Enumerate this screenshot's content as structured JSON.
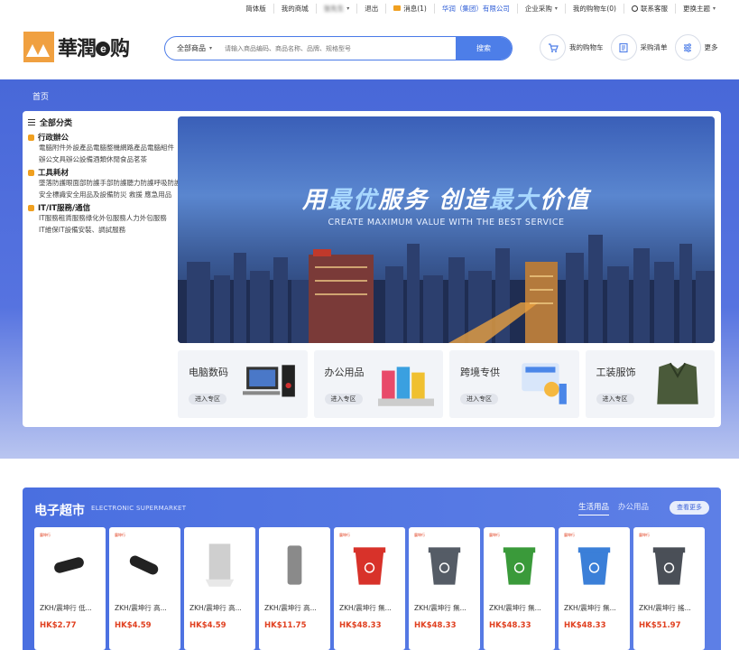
{
  "topbar": {
    "language": "简体版",
    "my_mall": "我的商城",
    "account": "张先生",
    "logout": "退出",
    "messages": "消息(1)",
    "company": "华润（集团）有限公司",
    "enterprise": "企业采购",
    "cart": "我的购物车(0)",
    "service": "联系客服",
    "theme": "更换主题"
  },
  "logo": {
    "text": "華潤",
    "suffix": "购",
    "e": "e"
  },
  "search": {
    "category": "全部商品",
    "placeholder": "请输入商品编码、商品名称、品牌、规格型号",
    "button": "搜索"
  },
  "header_actions": [
    {
      "label": "我的购物车",
      "icon": "cart-icon"
    },
    {
      "label": "采购清单",
      "icon": "list-icon"
    },
    {
      "label": "更多",
      "icon": "more-icon"
    }
  ],
  "hero": {
    "home": "首页"
  },
  "categories": {
    "title": "全部分类",
    "groups": [
      {
        "title": "行政辦公",
        "items": [
          "電腦附件",
          "外設產品",
          "電腦整機",
          "網路產品",
          "電腦組件",
          "辦公文具",
          "辦公設備",
          "酒類",
          "休閒食品",
          "茗茶"
        ]
      },
      {
        "title": "工具耗材",
        "items": [
          "墜落防護",
          "眼面部防護",
          "手部防護",
          "聽力防護",
          "呼吸防護",
          "安全標識",
          "安全用品及設備",
          "防災 救援 應急用品"
        ]
      },
      {
        "title": "IT/IT服務/通信",
        "items": [
          "IT服務",
          "租賃服務",
          "綠化外包服務",
          "人力外包服務",
          "IT維保",
          "IT設備安裝、調試服務"
        ]
      }
    ]
  },
  "banner": {
    "title_part1": "用",
    "title_hl1": "最优",
    "title_part2": "服务 创造",
    "title_hl2": "最大",
    "title_part3": "价值",
    "subtitle": "CREATE MAXIMUM VALUE WITH THE BEST SERVICE"
  },
  "tiles": [
    {
      "name": "电脑数码",
      "button": "进入专区"
    },
    {
      "name": "办公用品",
      "button": "进入专区"
    },
    {
      "name": "跨境专供",
      "button": "进入专区"
    },
    {
      "name": "工装服饰",
      "button": "进入专区"
    }
  ],
  "market": {
    "title": "电子超市",
    "subtitle": "ELECTRONIC SUPERMARKET",
    "tabs": [
      "生活用品",
      "办公用品"
    ],
    "more": "查看更多",
    "products": [
      {
        "name": "ZKH/震坤行 低...",
        "price": "HK$2.77",
        "badge": "震坤行",
        "color": "#222222"
      },
      {
        "name": "ZKH/震坤行 高...",
        "price": "HK$4.59",
        "badge": "震坤行",
        "color": "#222222"
      },
      {
        "name": "ZKH/震坤行 高...",
        "price": "HK$4.59",
        "badge": "",
        "color": "#cfcfcf"
      },
      {
        "name": "ZKH/震坤行 高...",
        "price": "HK$11.75",
        "badge": "",
        "color": "#8a8a8a"
      },
      {
        "name": "ZKH/震坤行 無...",
        "price": "HK$48.33",
        "badge": "震坤行",
        "color": "#d8322a"
      },
      {
        "name": "ZKH/震坤行 無...",
        "price": "HK$48.33",
        "badge": "震坤行",
        "color": "#555c66"
      },
      {
        "name": "ZKH/震坤行 無...",
        "price": "HK$48.33",
        "badge": "震坤行",
        "color": "#3a9a3a"
      },
      {
        "name": "ZKH/震坤行 無...",
        "price": "HK$48.33",
        "badge": "震坤行",
        "color": "#3b7fd8"
      },
      {
        "name": "ZKH/震坤行 搖...",
        "price": "HK$51.97",
        "badge": "震坤行",
        "color": "#4a4f57"
      }
    ]
  },
  "colors": {
    "brand_blue": "#4d7ee8",
    "price_red": "#e04020",
    "logo_orange": "#f0a040"
  }
}
